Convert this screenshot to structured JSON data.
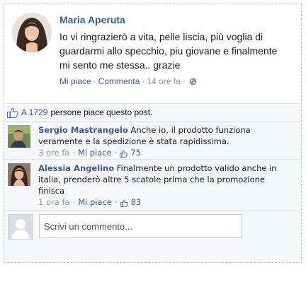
{
  "post": {
    "author": "Maria Aperuta",
    "text": "Io vi ringrazierò a vita, pelle liscia, più voglia di guardarmi allo specchio, piu giovane e finalmente mi sento me stessa.. grazie",
    "like_label": "Mi piace",
    "comment_label": "Commenta",
    "time": "14 ore fa",
    "separator": "·"
  },
  "likes_summary": {
    "prefix": "A 1729",
    "suffix": "persone piace questo post."
  },
  "comments": [
    {
      "author": "Sergio Mastrangelo",
      "text": "Anche io, il prodotto funziona veramente e la spedizione è stata rapidissima.",
      "time": "3 ore fa",
      "like_label": "Mi piace",
      "likes": "75"
    },
    {
      "author": "Alessia Angelino",
      "text": "Finalmente un prodotto valido anche in italia, prenderò altre 5 scatole prima che la promozione finisca",
      "time": "1 ora fa",
      "like_label": "Mi piace",
      "likes": "83"
    }
  ],
  "composer": {
    "placeholder": "Scrivi un commento..."
  },
  "colors": {
    "link": "#3b5998",
    "meta": "#90949c",
    "feedback_bg": "#f6f7f9"
  },
  "icons": [
    "thumbs-up-icon",
    "globe-icon"
  ]
}
